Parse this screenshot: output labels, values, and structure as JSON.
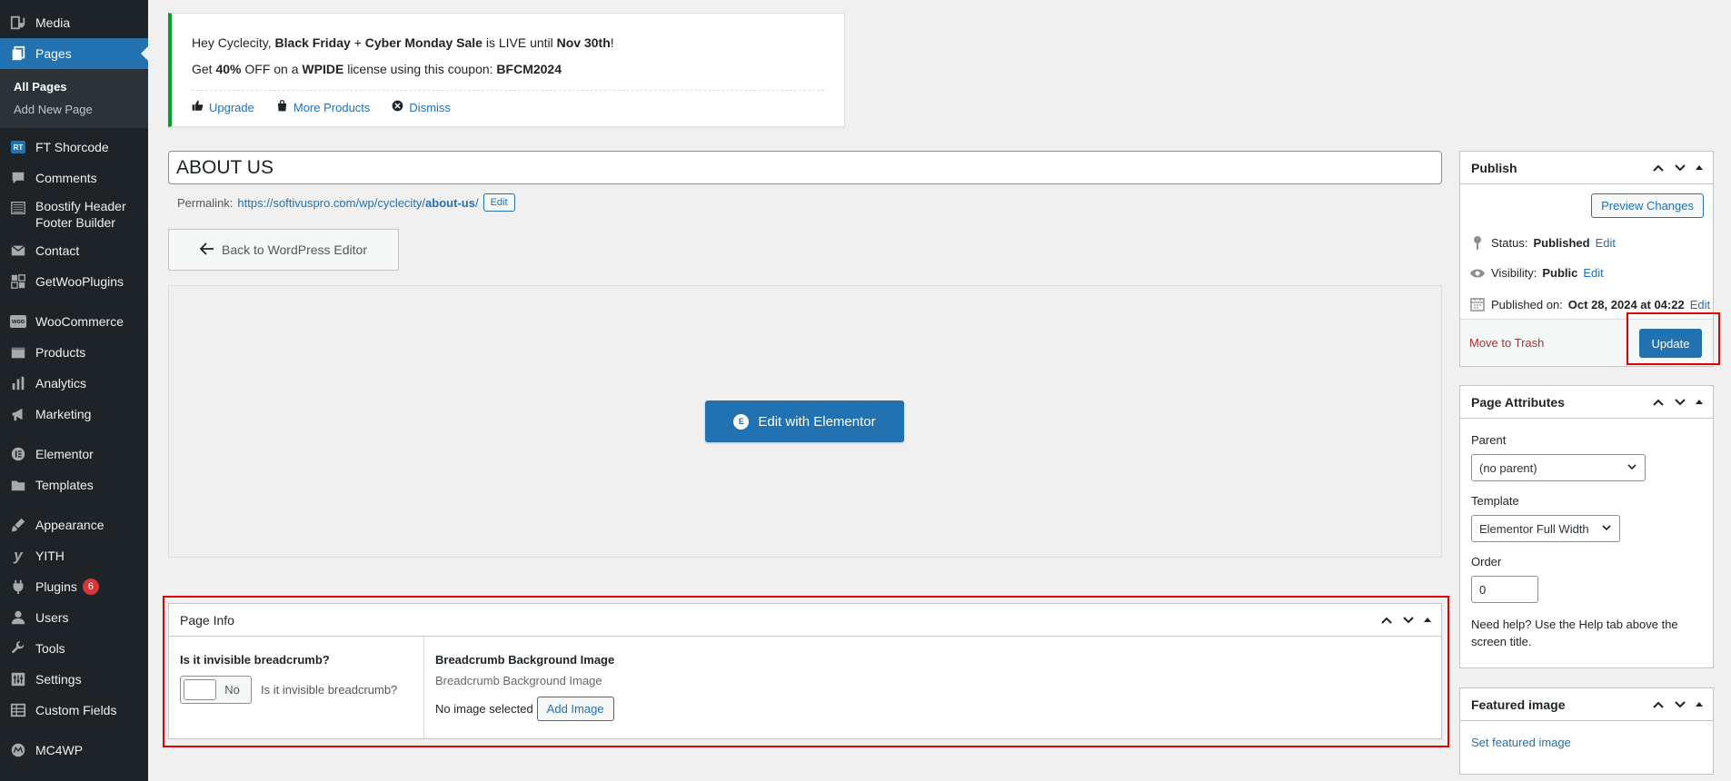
{
  "sidebar": {
    "items": [
      {
        "label": "Media",
        "icon": "media-icon"
      },
      {
        "label": "Pages",
        "icon": "pages-icon"
      },
      {
        "label": "FT Shorcode",
        "icon": "ft-shortcode-icon",
        "icon_text": "RT"
      },
      {
        "label": "Comments",
        "icon": "comments-icon"
      },
      {
        "label": "Boostify Header Footer Builder",
        "icon": "boostify-icon"
      },
      {
        "label": "Contact",
        "icon": "mail-icon"
      },
      {
        "label": "GetWooPlugins",
        "icon": "plugin-grid-icon"
      },
      {
        "label": "WooCommerce",
        "icon": "woocommerce-icon",
        "icon_text": "woo"
      },
      {
        "label": "Products",
        "icon": "products-icon"
      },
      {
        "label": "Analytics",
        "icon": "analytics-icon"
      },
      {
        "label": "Marketing",
        "icon": "megaphone-icon"
      },
      {
        "label": "Elementor",
        "icon": "elementor-icon"
      },
      {
        "label": "Templates",
        "icon": "folder-icon"
      },
      {
        "label": "Appearance",
        "icon": "brush-icon"
      },
      {
        "label": "YITH",
        "icon": "yith-icon"
      },
      {
        "label": "Plugins",
        "icon": "plugins-icon",
        "badge": "6"
      },
      {
        "label": "Users",
        "icon": "users-icon"
      },
      {
        "label": "Tools",
        "icon": "wrench-icon"
      },
      {
        "label": "Settings",
        "icon": "settings-icon"
      },
      {
        "label": "Custom Fields",
        "icon": "table-icon"
      },
      {
        "label": "MC4WP",
        "icon": "mc4wp-icon"
      }
    ],
    "submenu": [
      "All Pages",
      "Add New Page"
    ]
  },
  "notice": {
    "line1": {
      "p1": "Hey Cyclecity, ",
      "b1": "Black Friday",
      "p2": " + ",
      "b2": "Cyber Monday Sale",
      "p3": " is LIVE until ",
      "b3": "Nov 30th",
      "p4": "!"
    },
    "line2": {
      "p1": "Get ",
      "b1": "40%",
      "p2": " OFF on a ",
      "b2": "WPIDE",
      "p3": " license using this coupon: ",
      "b3": "BFCM2024"
    },
    "actions": [
      "Upgrade",
      "More Products",
      "Dismiss"
    ]
  },
  "editor": {
    "title": "ABOUT US",
    "permalink_label": "Permalink:",
    "permalink_base": "https://softivuspro.com/wp/cyclecity/",
    "permalink_slug": "about-us",
    "permalink_trail": "/",
    "edit_label": "Edit",
    "back_label": "Back to WordPress Editor",
    "elementor_label": "Edit with Elementor",
    "elementor_icon_text": "E"
  },
  "page_info": {
    "title": "Page Info",
    "breadcrumb_label": "Is it invisible breadcrumb?",
    "toggle_value": "No",
    "toggle_desc": "Is it invisible breadcrumb?",
    "bg_label": "Breadcrumb Background Image",
    "bg_sub": "Breadcrumb Background Image",
    "no_image": "No image selected",
    "add_image": "Add Image"
  },
  "publish": {
    "title": "Publish",
    "preview": "Preview Changes",
    "status_label": "Status:",
    "status_value": "Published",
    "visibility_label": "Visibility:",
    "visibility_value": "Public",
    "published_label": "Published on:",
    "published_value": "Oct 28, 2024 at 04:22",
    "edit": "Edit",
    "trash": "Move to Trash",
    "update": "Update"
  },
  "attributes": {
    "title": "Page Attributes",
    "parent_label": "Parent",
    "parent_value": "(no parent)",
    "template_label": "Template",
    "template_value": "Elementor Full Width",
    "order_label": "Order",
    "order_value": "0",
    "help": "Need help? Use the Help tab above the screen title."
  },
  "featured": {
    "title": "Featured image",
    "link": "Set featured image"
  },
  "colors": {
    "admin_bar": "#1d2327",
    "accent": "#2271b1",
    "highlight": "#e00000",
    "notice_border": "#00a32a"
  }
}
